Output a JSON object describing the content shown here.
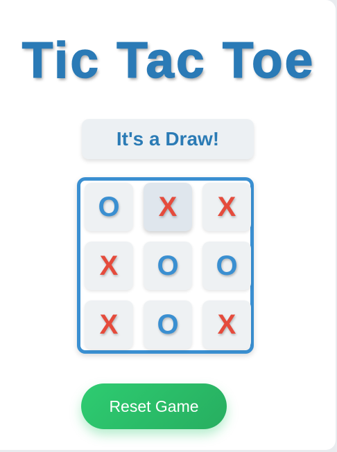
{
  "game": {
    "title": "Tic Tac Toe",
    "status": "It's a Draw!",
    "board": [
      {
        "mark": "O",
        "highlight": false
      },
      {
        "mark": "X",
        "highlight": true
      },
      {
        "mark": "X",
        "highlight": false
      },
      {
        "mark": "X",
        "highlight": false
      },
      {
        "mark": "O",
        "highlight": false
      },
      {
        "mark": "O",
        "highlight": false
      },
      {
        "mark": "X",
        "highlight": false
      },
      {
        "mark": "O",
        "highlight": false
      },
      {
        "mark": "X",
        "highlight": false
      }
    ],
    "reset_label": "Reset Game"
  },
  "colors": {
    "title": "#2a7ab6",
    "x_mark": "#e54b3c",
    "o_mark": "#3a8fd1",
    "board_border": "#3a8fd1",
    "reset_button": "#2ecc71"
  }
}
